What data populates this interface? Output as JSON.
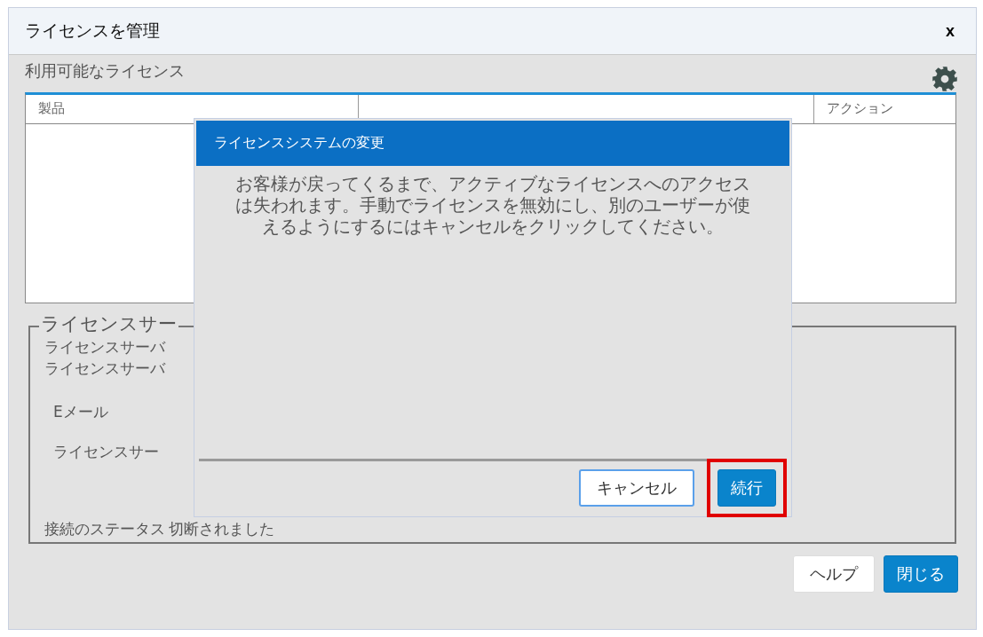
{
  "window": {
    "title": "ライセンスを管理",
    "close": "x"
  },
  "available_label": "利用可能なライセンス",
  "table": {
    "columns": [
      {
        "label": "製品"
      },
      {
        "label": "アクション"
      }
    ]
  },
  "server_group": {
    "legend": "ライセンスサー",
    "lines": [
      "ライセンスサーバ",
      "ライセンスサーバ"
    ],
    "email_label": "Eメール",
    "server_label": "ライセンスサー",
    "status_label": "接続のステータス",
    "status_value": "切断されました"
  },
  "buttons": [
    {
      "label": "ヘルプ",
      "kind": "secondary"
    },
    {
      "label": "閉じる",
      "kind": "primary"
    }
  ],
  "dialog": {
    "title": "ライセンスシステムの変更",
    "message": "お客様が戻ってくるまで、アクティブなライセンスへのアクセスは失われます。手動でライセンスを無効にし、別のユーザーが使えるようにするにはキャンセルをクリックしてください。",
    "buttons": [
      {
        "label": "キャンセル",
        "kind": "secondary",
        "highlighted": false
      },
      {
        "label": "続行",
        "kind": "primary",
        "highlighted": true
      }
    ]
  }
}
